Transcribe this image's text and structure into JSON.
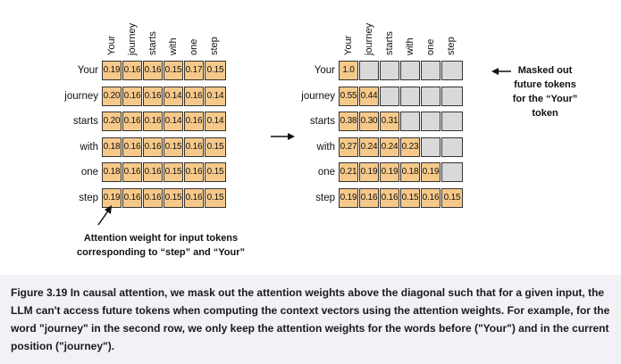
{
  "tokens": [
    "Your",
    "journey",
    "starts",
    "with",
    "one",
    "step"
  ],
  "left_matrix": [
    [
      "0.19",
      "0.16",
      "0.16",
      "0.15",
      "0.17",
      "0.15"
    ],
    [
      "0.20",
      "0.16",
      "0.16",
      "0.14",
      "0.16",
      "0.14"
    ],
    [
      "0.20",
      "0.16",
      "0.16",
      "0.14",
      "0.16",
      "0.14"
    ],
    [
      "0.18",
      "0.16",
      "0.16",
      "0.15",
      "0.16",
      "0.15"
    ],
    [
      "0.18",
      "0.16",
      "0.16",
      "0.15",
      "0.16",
      "0.15"
    ],
    [
      "0.19",
      "0.16",
      "0.16",
      "0.15",
      "0.16",
      "0.15"
    ]
  ],
  "right_matrix": [
    [
      "1.0",
      "",
      "",
      "",
      "",
      ""
    ],
    [
      "0.55",
      "0.44",
      "",
      "",
      "",
      ""
    ],
    [
      "0.38",
      "0.30",
      "0.31",
      "",
      "",
      ""
    ],
    [
      "0.27",
      "0.24",
      "0.24",
      "0.23",
      "",
      ""
    ],
    [
      "0.21",
      "0.19",
      "0.19",
      "0.18",
      "0.19",
      ""
    ],
    [
      "0.19",
      "0.16",
      "0.16",
      "0.15",
      "0.16",
      "0.15"
    ]
  ],
  "annotations": {
    "masked_out": [
      "Masked out",
      "future tokens",
      "for the “Your”",
      "token"
    ],
    "attention_weight": [
      "Attention weight for input tokens",
      "corresponding to “step” and “Your”"
    ]
  },
  "caption": "Figure 3.19 In causal attention, we mask out the attention weights above the diagonal such that for a given input, the LLM can't access future tokens when computing the context vectors using the attention weights. For example, for the word \"journey\" in the second row, we only keep the attention weights for the words before (\"Your\") and in the current position (\"journey\").",
  "colors": {
    "active_cell": "#f6c98a",
    "masked_cell": "#d9d9d9",
    "caption_bg": "#f3f0f6"
  }
}
